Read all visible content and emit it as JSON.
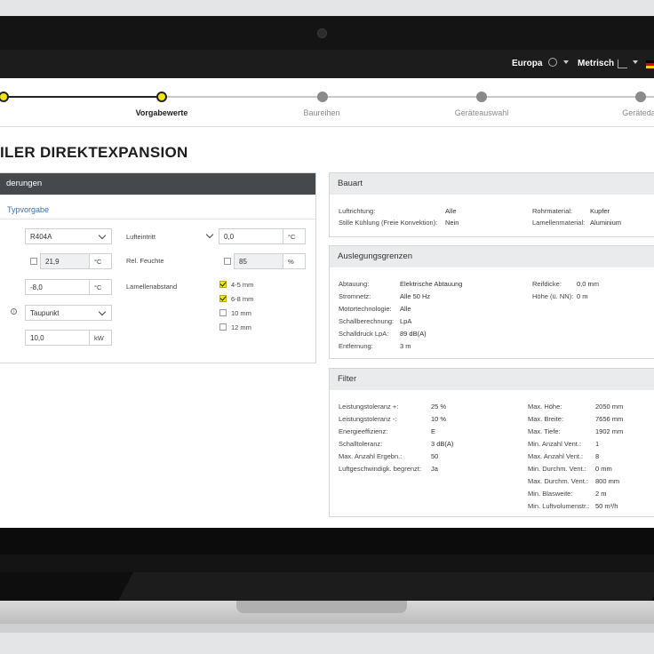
{
  "topbar": {
    "region": "Europa",
    "units": "Metrisch"
  },
  "steps": [
    {
      "label": "",
      "state": "done"
    },
    {
      "label": "Vorgabewerte",
      "state": "active"
    },
    {
      "label": "Baureihen",
      "state": "todo"
    },
    {
      "label": "Geräteauswahl",
      "state": "todo"
    },
    {
      "label": "Geräteda",
      "state": "todo"
    }
  ],
  "page_title": "ILER DIREKTEXPANSION",
  "left_panel": {
    "header": "derungen",
    "link": "Typvorgabe",
    "refrigerant": "R404A",
    "temp_value": "21,9",
    "temp_unit": "°C",
    "evap_value": "-8,0",
    "evap_unit": "°C",
    "mode_value": "Taupunkt",
    "power_value": "10,0",
    "power_unit": "kW",
    "air_inlet_label": "Lufteintritt",
    "air_inlet_value": "0,0",
    "air_inlet_unit": "°C",
    "humidity_label": "Rel. Feuchte",
    "humidity_value": "85",
    "humidity_unit": "%",
    "fin_spacing_label": "Lamellenabstand",
    "fin_options": [
      {
        "label": "4-5 mm",
        "checked": true
      },
      {
        "label": "6-8 mm",
        "checked": true
      },
      {
        "label": "10 mm",
        "checked": false
      },
      {
        "label": "12 mm",
        "checked": false
      }
    ]
  },
  "bauart": {
    "header": "Bauart",
    "rows": [
      [
        "Luftrichtung:",
        "Alle",
        "Rohrmaterial:",
        "Kupfer"
      ],
      [
        "Stille Kühlung (Freie Konvektion):",
        "Nein",
        "Lamellenmaterial:",
        "Aluminium"
      ]
    ]
  },
  "auslegung": {
    "header": "Auslegungsgrenzen",
    "left": [
      [
        "Abtauung:",
        "Elektrische Abtauung"
      ],
      [
        "Stromnetz:",
        "Alle 50 Hz"
      ],
      [
        "Motortechnologie:",
        "Alle"
      ],
      [
        "Schallberechnung:",
        "LpA"
      ],
      [
        "Schalldruck LpA:",
        "89 dB(A)"
      ],
      [
        "Entfernung:",
        "3 m"
      ]
    ],
    "right": [
      [
        "Reifdicke:",
        "0,0 mm"
      ],
      [
        "Höhe (ü. NN):",
        "0 m"
      ]
    ]
  },
  "filter": {
    "header": "Filter",
    "left": [
      [
        "Leistungstoleranz +:",
        "25 %"
      ],
      [
        "Leistungstoleranz -:",
        "10 %"
      ],
      [
        "Energieeffizienz:",
        "E"
      ],
      [
        "Schalltoleranz:",
        "3 dB(A)"
      ],
      [
        "Max. Anzahl Ergebn.:",
        "50"
      ],
      [
        "Luftgeschwindigk. begrenzt:",
        "Ja"
      ]
    ],
    "right": [
      [
        "Max. Höhe:",
        "2050 mm"
      ],
      [
        "Max. Breite:",
        "7656 mm"
      ],
      [
        "Max. Tiefe:",
        "1902 mm"
      ],
      [
        "Min. Anzahl Vent.:",
        "1"
      ],
      [
        "Max. Anzahl Vent.:",
        "8"
      ],
      [
        "Min. Durchm. Vent.:",
        "0 mm"
      ],
      [
        "Max. Durchm. Vent.:",
        "800 mm"
      ],
      [
        "Min. Blasweite:",
        "2 m"
      ],
      [
        "Min. Luftvolumenstr.:",
        "50 m³/h"
      ]
    ]
  },
  "colors": {
    "accent": "#f2e60e",
    "dark_header": "#45494c",
    "link": "#3a73b0"
  }
}
